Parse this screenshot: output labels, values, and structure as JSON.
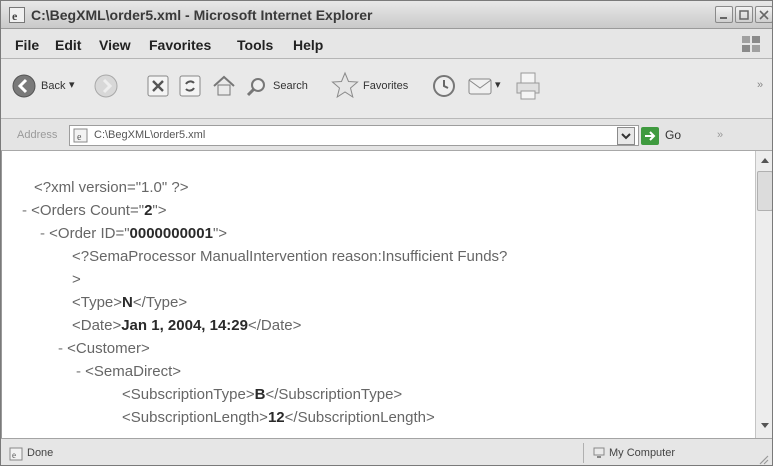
{
  "window": {
    "title": "C:\\BegXML\\order5.xml - Microsoft Internet Explorer"
  },
  "menu": {
    "items": [
      {
        "label": "File"
      },
      {
        "label": "Edit"
      },
      {
        "label": "View"
      },
      {
        "label": "Favorites"
      },
      {
        "label": "Tools"
      },
      {
        "label": "Help"
      }
    ]
  },
  "toolbar": {
    "back_label": "Back",
    "search_label": "Search",
    "favorites_label": "Favorites",
    "icons": [
      "back-icon",
      "forward-icon",
      "stop-icon",
      "refresh-icon",
      "home-icon",
      "search-icon",
      "favorites-star-icon",
      "history-icon",
      "mail-icon",
      "print-icon"
    ]
  },
  "address": {
    "label": "Address",
    "value": "C:\\BegXML\\order5.xml",
    "go_label": "Go"
  },
  "content": {
    "lines": [
      {
        "prefix": "",
        "open": "<?xml version=\"1.0\" ?>",
        "value": "",
        "close": ""
      },
      {
        "prefix": "-",
        "open": "<Orders Count=\"",
        "value": "2",
        "close": "\">"
      },
      {
        "prefix": "-",
        "open": "<Order ID=\"",
        "value": "0000000001",
        "close": "\">"
      },
      {
        "prefix": "",
        "open": "<?SemaProcessor ManualIntervention reason:Insufficient Funds?",
        "value": "",
        "close": ""
      },
      {
        "prefix": "",
        "open": ">",
        "value": "",
        "close": ""
      },
      {
        "prefix": "",
        "open": "<Type>",
        "value": "N",
        "close": "</Type>"
      },
      {
        "prefix": "",
        "open": "<Date>",
        "value": "Jan 1, 2004, 14:29",
        "close": "</Date>"
      },
      {
        "prefix": "-",
        "open": "<Customer>",
        "value": "",
        "close": ""
      },
      {
        "prefix": "-",
        "open": "<SemaDirect>",
        "value": "",
        "close": ""
      },
      {
        "prefix": "",
        "open": "<SubscriptionType>",
        "value": "B",
        "close": "</SubscriptionType>"
      },
      {
        "prefix": "",
        "open": "<SubscriptionLength>",
        "value": "12",
        "close": "</SubscriptionLength>"
      }
    ]
  },
  "status": {
    "text": "Done",
    "zone": "My Computer"
  }
}
